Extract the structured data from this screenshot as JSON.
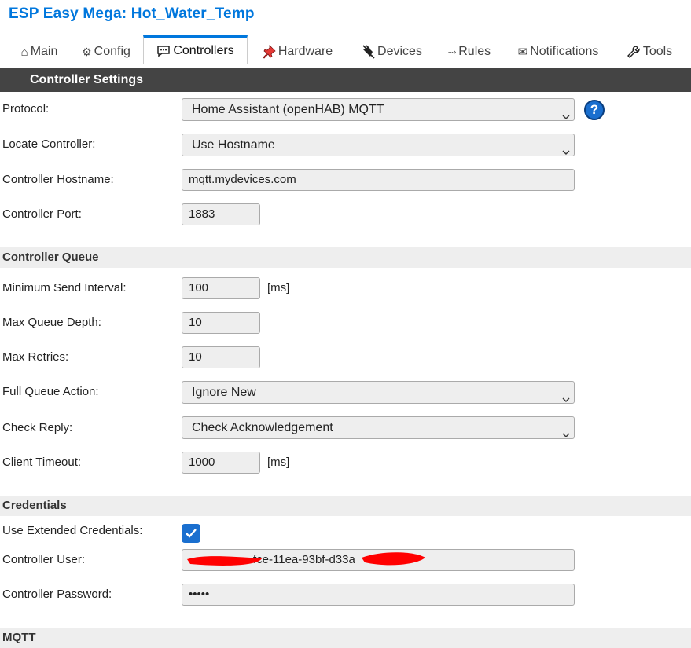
{
  "page": {
    "title": "ESP Easy Mega: Hot_Water_Temp"
  },
  "tabs": [
    {
      "label": "Main",
      "glyph": "⌂",
      "icon": "home-icon"
    },
    {
      "label": "Config",
      "glyph": "⚙",
      "icon": "gear-icon"
    },
    {
      "label": "Controllers",
      "icon": "chat-bubble-icon",
      "active": true
    },
    {
      "label": "Hardware",
      "icon": "pushpin-icon"
    },
    {
      "label": "Devices",
      "icon": "plug-icon"
    },
    {
      "label": "Rules",
      "glyph": "⤑",
      "icon": "arrow-icon"
    },
    {
      "label": "Notifications",
      "glyph": "✉",
      "icon": "envelope-icon"
    },
    {
      "label": "Tools",
      "icon": "wrench-icon"
    }
  ],
  "controller_settings": {
    "heading": "Controller Settings",
    "protocol": {
      "label": "Protocol:",
      "value": "Home Assistant (openHAB) MQTT",
      "help": "?"
    },
    "locate": {
      "label": "Locate Controller:",
      "value": "Use Hostname"
    },
    "hostname": {
      "label": "Controller Hostname:",
      "value": "mqtt.mydevices.com"
    },
    "port": {
      "label": "Controller Port:",
      "value": "1883"
    }
  },
  "queue": {
    "heading": "Controller Queue",
    "min_interval": {
      "label": "Minimum Send Interval:",
      "value": "100",
      "unit": "[ms]"
    },
    "max_depth": {
      "label": "Max Queue Depth:",
      "value": "10"
    },
    "max_retries": {
      "label": "Max Retries:",
      "value": "10"
    },
    "full_action": {
      "label": "Full Queue Action:",
      "value": "Ignore New"
    },
    "check_reply": {
      "label": "Check Reply:",
      "value": "Check Acknowledgement"
    },
    "timeout": {
      "label": "Client Timeout:",
      "value": "1000",
      "unit": "[ms]"
    }
  },
  "credentials": {
    "heading": "Credentials",
    "extended": {
      "label": "Use Extended Credentials:",
      "checked": true
    },
    "user": {
      "label": "Controller User:",
      "value": "fce-11ea-93bf-d33a"
    },
    "password": {
      "label": "Controller Password:",
      "value": "•••••"
    }
  },
  "next_section": {
    "heading": "MQTT"
  },
  "colors": {
    "accent": "#0077dd",
    "header_bar": "#444444",
    "redaction": "#ff0000"
  }
}
